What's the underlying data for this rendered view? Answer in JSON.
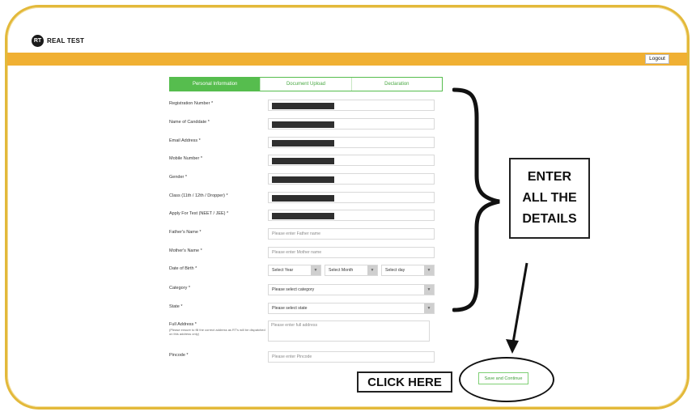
{
  "app": {
    "logo_text": "REAL TEST",
    "logo_mark": "RT"
  },
  "header": {
    "logout_label": "Logout"
  },
  "tabs": [
    {
      "label": "Personal Information",
      "active": true
    },
    {
      "label": "Document Upload",
      "active": false
    },
    {
      "label": "Declaration",
      "active": false
    }
  ],
  "form": {
    "registration_number": {
      "label": "Registration Number *"
    },
    "name_of_candidate": {
      "label": "Name of Canddate *"
    },
    "email_address": {
      "label": "Email Address *"
    },
    "mobile_number": {
      "label": "Mobile Number *"
    },
    "gender": {
      "label": "Gender *"
    },
    "class": {
      "label": "Class (11th / 12th / Dropper) *"
    },
    "apply_for_test": {
      "label": "Apply For Test (NEET / JEE) *"
    },
    "fathers_name": {
      "label": "Father's Name *",
      "placeholder": "Please enter Father name"
    },
    "mothers_name": {
      "label": "Mother's Name *",
      "placeholder": "Please enter Mother name"
    },
    "date_of_birth": {
      "label": "Date of Birth *",
      "year": "Select Year",
      "month": "Select Month",
      "day": "Select day"
    },
    "category": {
      "label": "Category *",
      "value": "Please select category"
    },
    "state": {
      "label": "State *",
      "value": "Please select state"
    },
    "full_address": {
      "label": "Full Address *",
      "note": "(Please ensure to fill the correct address as RT's will be dispatched on this address only)",
      "placeholder": "Please enter full address"
    },
    "pincode": {
      "label": "Pincode *",
      "placeholder": "Please enter Pincode"
    }
  },
  "save_button_label": "Save and Continue",
  "annotations": {
    "enter_text": "ENTER\nALL THE\nDETAILS",
    "click_text": "CLICK HERE"
  },
  "colors": {
    "accent_green": "#56bd4e",
    "topbar_orange": "#f0b033",
    "frame_gold": "#e3b93a"
  },
  "icons": {
    "dropdown": "chevron-down-icon",
    "logo": "rt-logo-icon"
  }
}
